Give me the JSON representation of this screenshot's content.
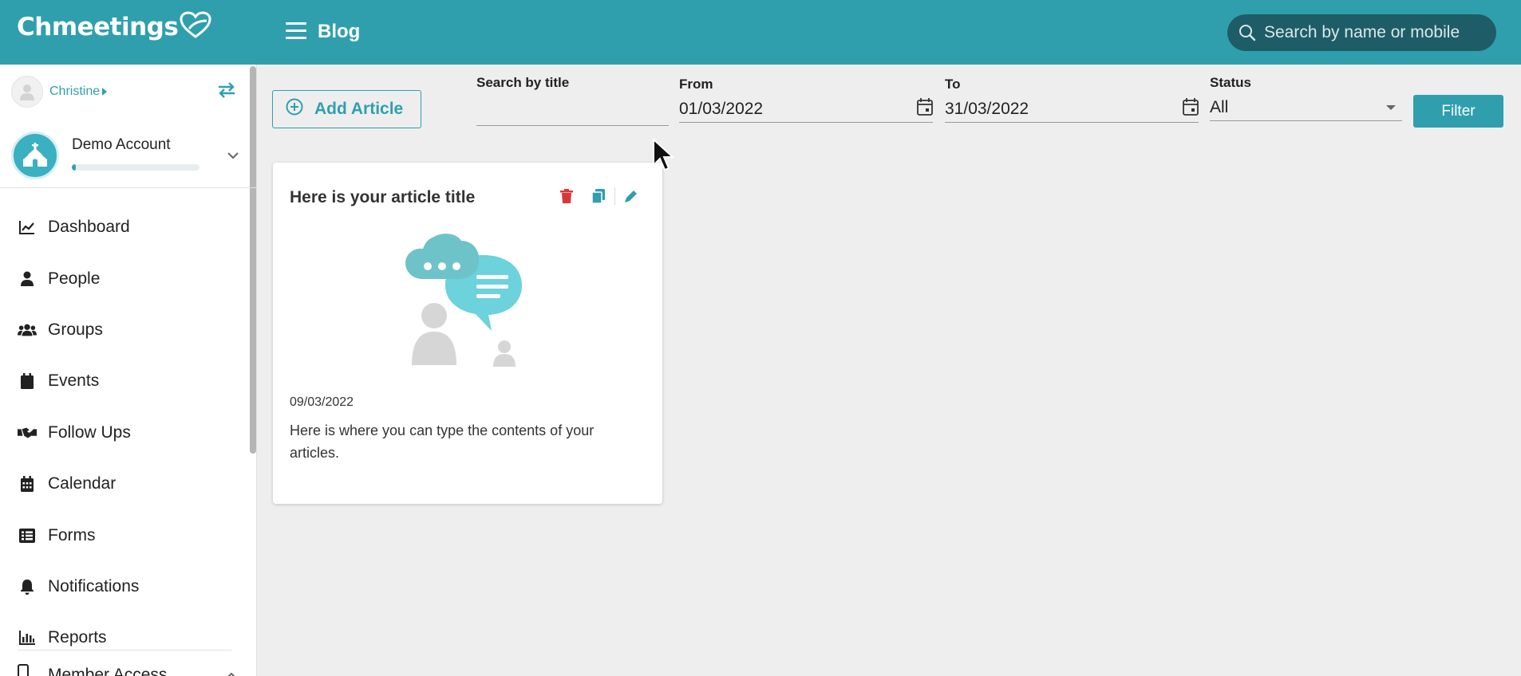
{
  "header": {
    "brand": "Chmeetings",
    "page_title": "Blog",
    "search_placeholder": "Search by name or mobile"
  },
  "sidebar": {
    "user_name": "Christine",
    "account_name": "Demo Account",
    "account_progress": 0.03,
    "items": [
      {
        "label": "Dashboard",
        "icon": "chart-line-icon"
      },
      {
        "label": "People",
        "icon": "user-icon"
      },
      {
        "label": "Groups",
        "icon": "users-icon"
      },
      {
        "label": "Events",
        "icon": "calendar-icon"
      },
      {
        "label": "Follow Ups",
        "icon": "handshake-icon"
      },
      {
        "label": "Calendar",
        "icon": "calendar-grid-icon"
      },
      {
        "label": "Forms",
        "icon": "list-icon"
      },
      {
        "label": "Notifications",
        "icon": "bell-icon"
      },
      {
        "label": "Reports",
        "icon": "bar-chart-icon"
      }
    ],
    "member_access": "Member Access"
  },
  "filters": {
    "add_article_label": "Add Article",
    "search_title_label": "Search by title",
    "search_title_value": "",
    "from_label": "From",
    "from_value": "01/03/2022",
    "to_label": "To",
    "to_value": "31/03/2022",
    "status_label": "Status",
    "status_value": "All",
    "filter_label": "Filter"
  },
  "article": {
    "title": "Here is your article title",
    "date": "09/03/2022",
    "body": "Here is where you can type the contents of your articles."
  },
  "colors": {
    "brand": "#2f9fae",
    "search_bg": "#1e5d67",
    "delete": "#d9383a",
    "page_bg": "#eeeeee"
  }
}
